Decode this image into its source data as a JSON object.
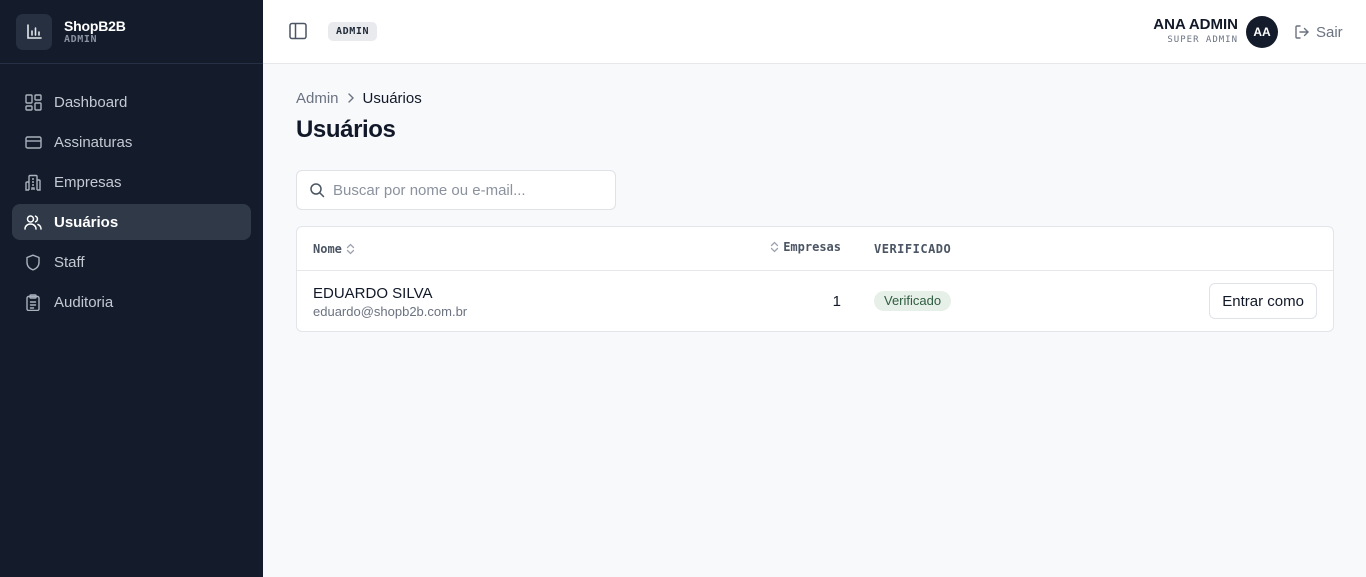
{
  "brand": {
    "name": "ShopB2B",
    "subtitle": "ADMIN",
    "logo_icon": "bar-chart-icon"
  },
  "sidebar": {
    "items": [
      {
        "label": "Dashboard",
        "icon": "dashboard-grid-icon",
        "active": false
      },
      {
        "label": "Assinaturas",
        "icon": "credit-card-icon",
        "active": false
      },
      {
        "label": "Empresas",
        "icon": "building-icon",
        "active": false
      },
      {
        "label": "Usuários",
        "icon": "users-icon",
        "active": true
      },
      {
        "label": "Staff",
        "icon": "shield-icon",
        "active": false
      },
      {
        "label": "Auditoria",
        "icon": "clipboard-icon",
        "active": false
      }
    ]
  },
  "topbar": {
    "badge": "ADMIN",
    "user_name": "ANA ADMIN",
    "user_role": "SUPER ADMIN",
    "avatar_initials": "AA",
    "logout_label": "Sair"
  },
  "breadcrumb": {
    "parent": "Admin",
    "current": "Usuários"
  },
  "page_title": "Usuários",
  "search": {
    "placeholder": "Buscar por nome ou e-mail...",
    "value": ""
  },
  "table": {
    "columns": {
      "name": "Nome",
      "companies": "Empresas",
      "verified": "VERIFICADO"
    },
    "rows": [
      {
        "name": "EDUARDO SILVA",
        "email": "eduardo@shopb2b.com.br",
        "companies": "1",
        "status": "Verificado",
        "action": "Entrar como"
      }
    ]
  },
  "colors": {
    "sidebar_bg": "#141c2b",
    "active_item_bg": "#2f3948",
    "page_bg": "#f8f9fb",
    "verified_badge_bg": "#e7efe9",
    "verified_badge_text": "#2f5d3f"
  }
}
